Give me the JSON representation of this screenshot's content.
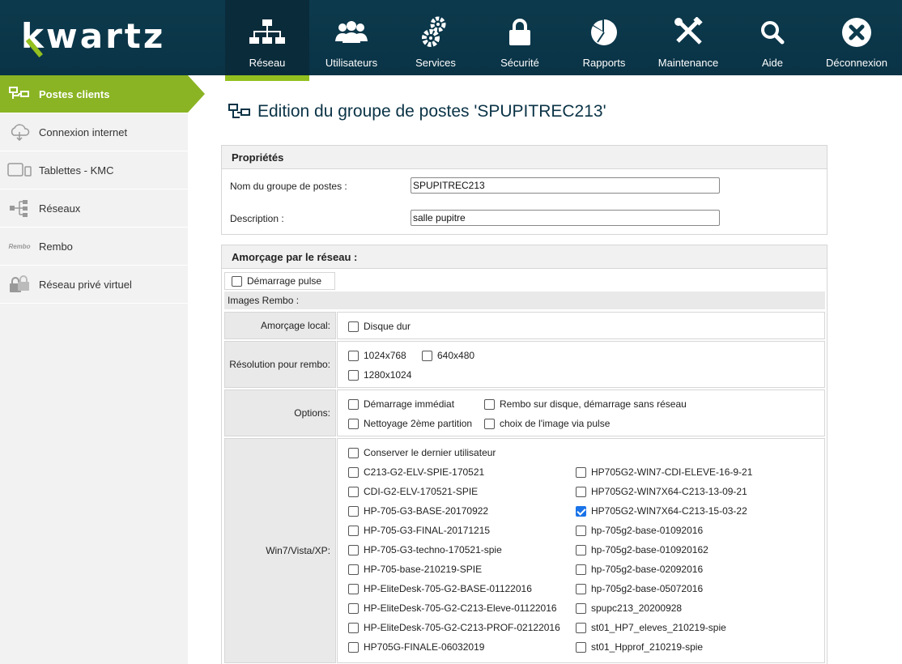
{
  "app": {
    "logo": "kwartz"
  },
  "nav": [
    {
      "label": "Réseau",
      "icon": "network-icon",
      "active": true
    },
    {
      "label": "Utilisateurs",
      "icon": "users-icon"
    },
    {
      "label": "Services",
      "icon": "gears-icon"
    },
    {
      "label": "Sécurité",
      "icon": "lock-icon"
    },
    {
      "label": "Rapports",
      "icon": "pie-chart-icon"
    },
    {
      "label": "Maintenance",
      "icon": "tools-icon"
    },
    {
      "label": "Aide",
      "icon": "search-icon"
    },
    {
      "label": "Déconnexion",
      "icon": "close-icon"
    }
  ],
  "sidebar": {
    "items": [
      {
        "label": "Postes clients",
        "icon": "workstations-icon",
        "active": true
      },
      {
        "label": "Connexion internet",
        "icon": "cloud-icon"
      },
      {
        "label": "Tablettes - KMC",
        "icon": "tablet-icon"
      },
      {
        "label": "Réseaux",
        "icon": "network-tree-icon"
      },
      {
        "label": "Rembo",
        "icon": "rembo-logo",
        "logo_text": "Rembo"
      },
      {
        "label": "Réseau privé virtuel",
        "icon": "vpn-lock-icon"
      }
    ]
  },
  "page": {
    "title": "Edition du groupe de postes 'SPUPITREC213'"
  },
  "properties": {
    "header": "Propriétés",
    "name_label": "Nom du groupe de postes :",
    "name_value": "SPUPITREC213",
    "desc_label": "Description :",
    "desc_value": "salle pupitre"
  },
  "boot": {
    "header": "Amorçage par le réseau :",
    "pulse_label": "Démarrage pulse",
    "pulse_checked": false,
    "images_strip": "Images Rembo :",
    "local_label": "Amorçage local:",
    "local_option": "Disque dur",
    "resolution_label": "Résolution pour rembo:",
    "resolutions": [
      "1024x768",
      "640x480",
      "1280x1024"
    ],
    "options_label": "Options:",
    "options": [
      "Démarrage immédiat",
      "Rembo sur disque, démarrage sans réseau",
      "Nettoyage 2ème partition",
      "choix de l'image via pulse"
    ],
    "images_label": "Win7/Vista/XP:",
    "keep_user": "Conserver le dernier utilisateur",
    "images_left": [
      "C213-G2-ELV-SPIE-170521",
      "CDI-G2-ELV-170521-SPIE",
      "HP-705-G3-BASE-20170922",
      "HP-705-G3-FINAL-20171215",
      "HP-705-G3-techno-170521-spie",
      "HP-705-base-210219-SPIE",
      "HP-EliteDesk-705-G2-BASE-01122016",
      "HP-EliteDesk-705-G2-C213-Eleve-01122016",
      "HP-EliteDesk-705-G2-C213-PROF-02122016",
      "HP705G-FINALE-06032019"
    ],
    "images_right": [
      "HP705G2-WIN7-CDI-ELEVE-16-9-21",
      "HP705G2-WIN7X64-C213-13-09-21",
      "HP705G2-WIN7X64-C213-15-03-22",
      "hp-705g2-base-01092016",
      "hp-705g2-base-010920162",
      "hp-705g2-base-02092016",
      "hp-705g2-base-05072016",
      "spupc213_20200928",
      "st01_HP7_eleves_210219-spie",
      "st01_Hpprof_210219-spie"
    ],
    "checked_image": "HP705G2-WIN7X64-C213-15-03-22"
  }
}
